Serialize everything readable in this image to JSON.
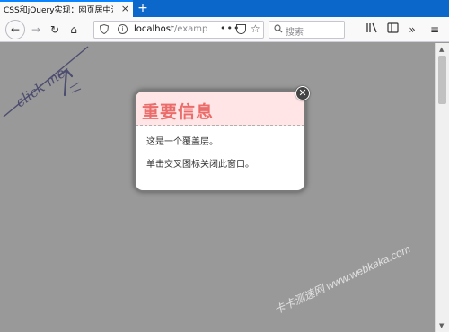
{
  "browser": {
    "tab_title": "CSS和jQuery实现：网页居中漂出",
    "tab_close": "×",
    "new_tab": "+",
    "url_host": "localhost",
    "url_rest": "/examp",
    "url_dots": "•••",
    "search_placeholder": "搜索"
  },
  "icons": {
    "back": "←",
    "forward": "→",
    "reload": "↻",
    "home": "⌂",
    "shield": "🛡",
    "info": "i",
    "star": "☆",
    "search": "🔍",
    "library": "|||\\",
    "sidebar": "▯",
    "more": "»",
    "menu": "≡",
    "close": "✕"
  },
  "page": {
    "click_me": "click me"
  },
  "popup": {
    "title": "重要信息",
    "line1": "这是一个覆盖层。",
    "line2": "单击交叉图标关闭此窗口。"
  },
  "watermark": {
    "text": "卡卡测速网 www.webkaka.com"
  }
}
